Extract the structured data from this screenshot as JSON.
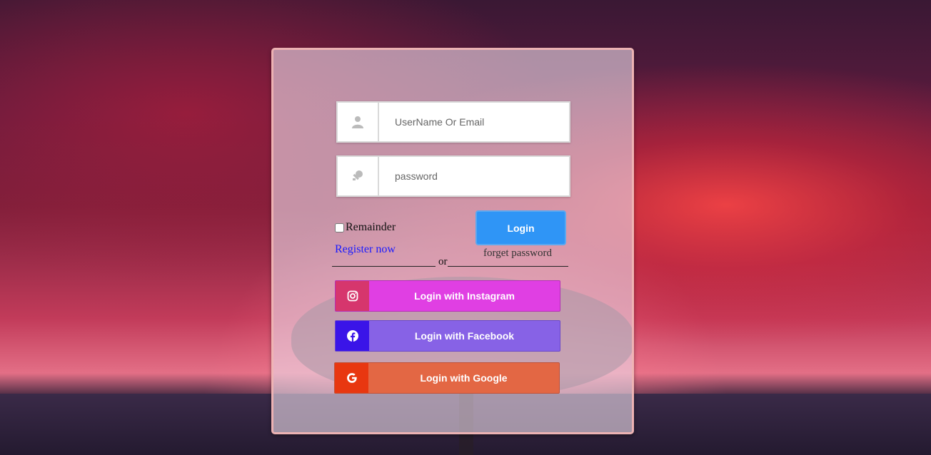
{
  "login_form": {
    "username_placeholder": "UserName Or Email",
    "password_placeholder": "password",
    "remember_label": "Remainder",
    "login_button": "Login",
    "register_link": "Register now",
    "forget_link": "forget password",
    "or_separator": "or"
  },
  "social_logins": {
    "instagram": {
      "label": "Login with Instagram",
      "icon": "instagram-icon",
      "color": "#e03fe3"
    },
    "facebook": {
      "label": "Login with Facebook",
      "icon": "facebook-icon",
      "color": "#8762e6"
    },
    "google": {
      "label": "Login with Google",
      "icon": "google-icon",
      "color": "#e36744"
    }
  },
  "colors": {
    "login_button": "#2f95f6",
    "register_link": "#1a1aff",
    "card_border": "#f0b4b4"
  }
}
